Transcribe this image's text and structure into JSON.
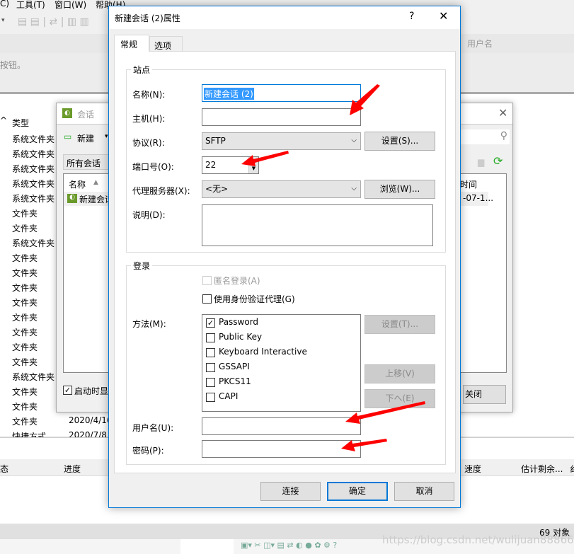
{
  "app": {
    "menu": [
      "C)",
      "工具(T)",
      "窗口(W)",
      "帮助(H)"
    ],
    "hint_text": "按钮。",
    "header_right": "用户名",
    "list_header_arrow": "^",
    "list_header_type": "类型",
    "types": [
      "系统文件夹",
      "系统文件夹",
      "系统文件夹",
      "系统文件夹",
      "系统文件夹",
      "文件夹",
      "文件夹",
      "系统文件夹",
      "文件夹",
      "文件夹",
      "文件夹",
      "文件夹",
      "文件夹",
      "文件夹",
      "文件夹",
      "文件夹",
      "系统文件夹",
      "文件夹",
      "文件夹",
      "文件夹",
      "快捷方式"
    ],
    "dates": [
      "2020/4/16",
      "2020/7/8"
    ],
    "transfer_headers": [
      "态",
      "进度",
      "速度",
      "估计剩余...",
      "纟"
    ],
    "status_count": "69 对象",
    "watermark": "https://blog.csdn.net/wulijuan888666"
  },
  "session_window": {
    "title": "会话",
    "new_label": "新建",
    "filter": "所有会话",
    "col_name": "名称",
    "col_time": "时间",
    "row_name": "新建会话",
    "row_time": "-07-1...",
    "startup_label": "启动时显",
    "startup_checked": true,
    "close_label": "关闭"
  },
  "dialog": {
    "title": "新建会话 (2)属性",
    "help": "?",
    "tabs": [
      "常规",
      "选项"
    ],
    "site_group": "站点",
    "name_label": "名称(N):",
    "name_value": "新建会话 (2)",
    "host_label": "主机(H):",
    "host_value": "",
    "protocol_label": "协议(R):",
    "protocol_value": "SFTP",
    "protocol_settings": "设置(S)...",
    "port_label": "端口号(O):",
    "port_value": "22",
    "proxy_label": "代理服务器(X):",
    "proxy_value": "<无>",
    "proxy_browse": "浏览(W)...",
    "desc_label": "说明(D):",
    "desc_value": "",
    "login_group": "登录",
    "anonymous": "匿名登录(A)",
    "agent": "使用身份验证代理(G)",
    "method_label": "方法(M):",
    "methods": [
      {
        "name": "Password",
        "checked": true
      },
      {
        "name": "Public Key",
        "checked": false
      },
      {
        "name": "Keyboard Interactive",
        "checked": false
      },
      {
        "name": "GSSAPI",
        "checked": false
      },
      {
        "name": "PKCS11",
        "checked": false
      },
      {
        "name": "CAPI",
        "checked": false
      }
    ],
    "method_settings": "设置(T)...",
    "move_up": "上移(V)",
    "move_down": "下へ(E)",
    "user_label": "用户名(U):",
    "user_value": "",
    "pass_label": "密码(P):",
    "pass_value": "",
    "connect": "连接",
    "ok": "确定",
    "cancel": "取消"
  },
  "colors": {
    "accent": "#0078d7",
    "arrow": "#ff0000",
    "selection": "#3399ff"
  }
}
